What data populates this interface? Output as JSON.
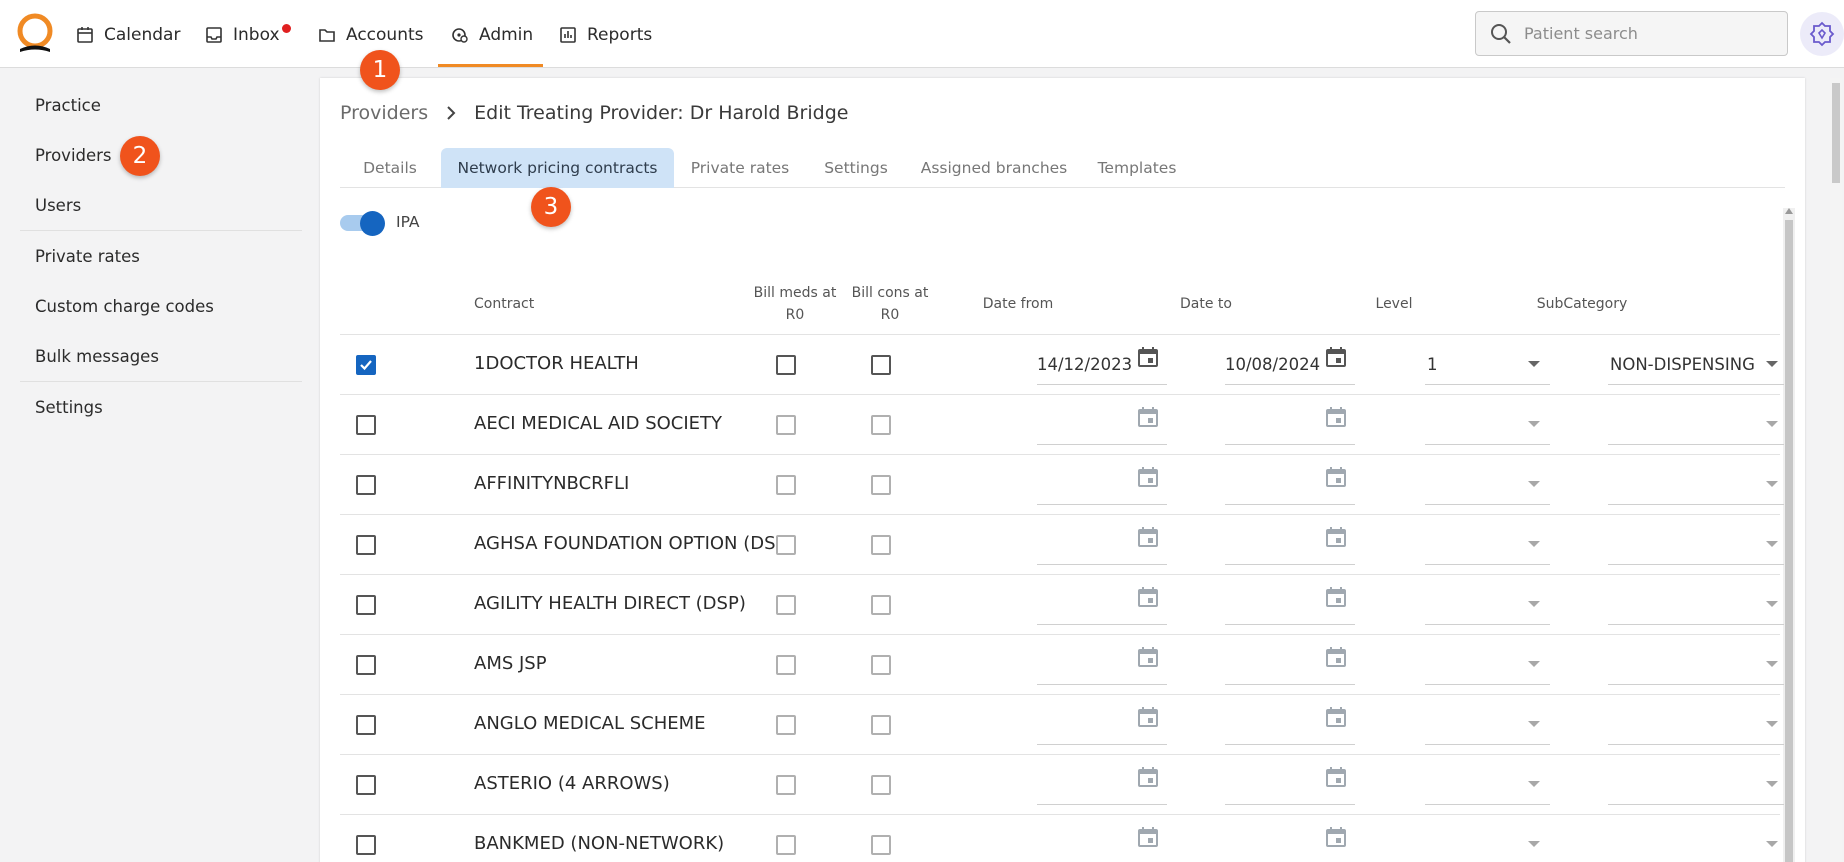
{
  "nav": {
    "items": [
      {
        "label": "Calendar",
        "icon": "calendar-icon"
      },
      {
        "label": "Inbox",
        "icon": "inbox-icon",
        "has_notification": true
      },
      {
        "label": "Accounts",
        "icon": "folder-icon"
      },
      {
        "label": "Admin",
        "icon": "admin-icon",
        "active": true
      },
      {
        "label": "Reports",
        "icon": "reports-icon"
      }
    ],
    "search_placeholder": "Patient search",
    "accent_color": "#f08a24"
  },
  "sidebar": {
    "items": [
      {
        "label": "Practice"
      },
      {
        "label": "Providers"
      },
      {
        "label": "Users"
      },
      {
        "label": "Private rates"
      },
      {
        "label": "Custom charge codes"
      },
      {
        "label": "Bulk messages"
      },
      {
        "label": "Settings"
      }
    ]
  },
  "breadcrumb": {
    "parent": "Providers",
    "current": "Edit Treating Provider: Dr Harold Bridge"
  },
  "tabs": [
    {
      "label": "Details"
    },
    {
      "label": "Network pricing contracts",
      "active": true
    },
    {
      "label": "Private rates"
    },
    {
      "label": "Settings"
    },
    {
      "label": "Assigned branches"
    },
    {
      "label": "Templates"
    }
  ],
  "ipa": {
    "label": "IPA",
    "enabled": true
  },
  "table": {
    "headers": {
      "contract": "Contract",
      "bill_meds_line1": "Bill meds at",
      "bill_meds_line2": "R0",
      "bill_cons_line1": "Bill cons at",
      "bill_cons_line2": "R0",
      "date_from": "Date from",
      "date_to": "Date to",
      "level": "Level",
      "subcategory": "SubCategory"
    },
    "rows": [
      {
        "contract": "1DOCTOR HEALTH",
        "selected": true,
        "bill_meds": false,
        "bill_cons": false,
        "date_from": "14/12/2023",
        "date_to": "10/08/2024",
        "level": "1",
        "subcategory": "NON-DISPENSING"
      },
      {
        "contract": "AECI MEDICAL AID SOCIETY",
        "selected": false,
        "date_from": "",
        "date_to": "",
        "level": "",
        "subcategory": ""
      },
      {
        "contract": "AFFINITYNBCRFLI",
        "selected": false,
        "date_from": "",
        "date_to": "",
        "level": "",
        "subcategory": ""
      },
      {
        "contract": "AGHSA FOUNDATION OPTION (DSP)",
        "selected": false,
        "date_from": "",
        "date_to": "",
        "level": "",
        "subcategory": ""
      },
      {
        "contract": "AGILITY HEALTH DIRECT (DSP)",
        "selected": false,
        "date_from": "",
        "date_to": "",
        "level": "",
        "subcategory": ""
      },
      {
        "contract": "AMS JSP",
        "selected": false,
        "date_from": "",
        "date_to": "",
        "level": "",
        "subcategory": ""
      },
      {
        "contract": "ANGLO MEDICAL SCHEME",
        "selected": false,
        "date_from": "",
        "date_to": "",
        "level": "",
        "subcategory": ""
      },
      {
        "contract": "ASTERIO (4 ARROWS)",
        "selected": false,
        "date_from": "",
        "date_to": "",
        "level": "",
        "subcategory": ""
      },
      {
        "contract": "BANKMED (NON-NETWORK)",
        "selected": false,
        "date_from": "",
        "date_to": "",
        "level": "",
        "subcategory": ""
      }
    ]
  },
  "markers": [
    "1",
    "2",
    "3"
  ]
}
